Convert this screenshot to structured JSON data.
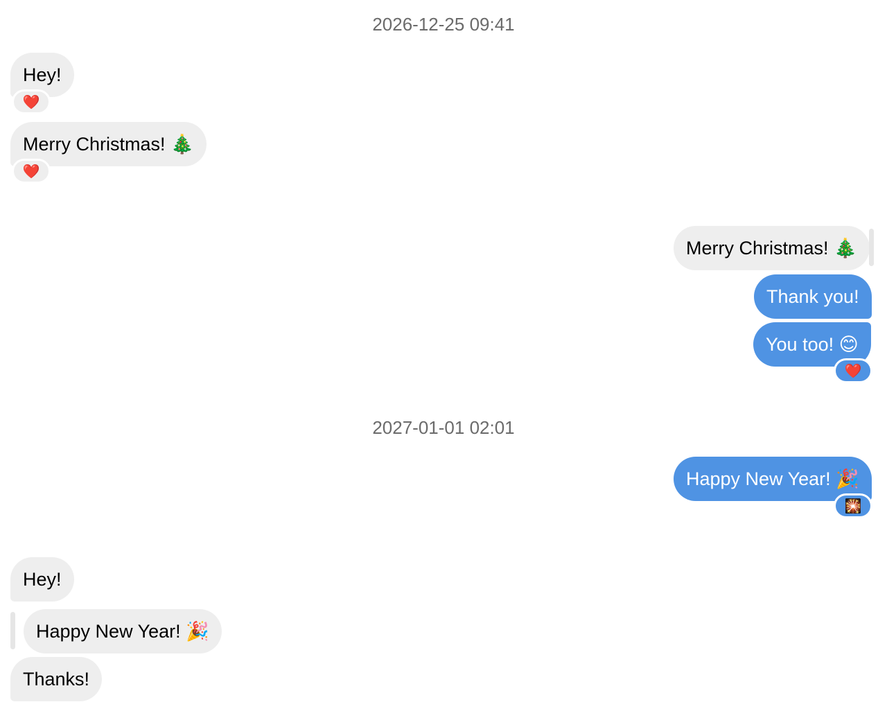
{
  "conversation": {
    "timestamps": [
      "2026-12-25 09:41",
      "2027-01-01 02:01"
    ],
    "messages": [
      {
        "text": "Hey!",
        "direction": "incoming",
        "reaction": "❤️"
      },
      {
        "text": "Merry Christmas! 🎄",
        "direction": "incoming",
        "reaction": "❤️"
      },
      {
        "text": "Merry Christmas! 🎄",
        "direction": "incoming-quoted"
      },
      {
        "text": "Thank you!",
        "direction": "outgoing"
      },
      {
        "text": "You too! 😊",
        "direction": "outgoing",
        "reaction": "❤️"
      },
      {
        "text": "Happy New Year! 🎉",
        "direction": "outgoing",
        "reaction": "🎇"
      },
      {
        "text": "Hey!",
        "direction": "incoming"
      },
      {
        "text": "Happy New Year! 🎉",
        "direction": "incoming-quoted"
      },
      {
        "text": "Thanks!",
        "direction": "incoming"
      }
    ]
  },
  "colors": {
    "incoming_bubble": "#eeeeee",
    "outgoing_bubble": "#4f93e3",
    "timestamp_text": "#6b6b6b"
  }
}
